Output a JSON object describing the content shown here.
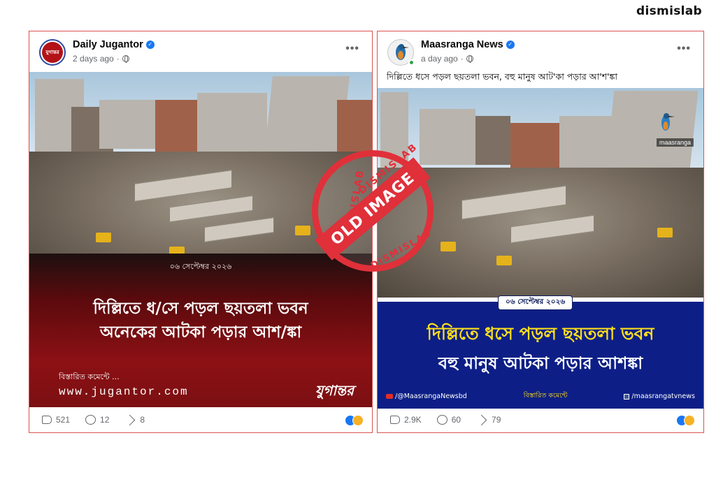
{
  "brand": {
    "name": "dismislab"
  },
  "left_post": {
    "page_name": "Daily Jugantor",
    "time": "2 days ago",
    "avatar_text": "যুগান্তর",
    "media": {
      "date": "০৬ সেপ্টেম্বর ২০২৬",
      "headline_line1": "দিল্লিতে ধ/সে পড়ল ছয়তলা ভবন",
      "headline_line2": "অনেকের আটকা পড়ার আশ/ঙ্কা",
      "more_text": "বিস্তারিত কমেন্টে ...",
      "website": "www.jugantor.com",
      "logo": "যুগান্তর"
    },
    "stats": {
      "likes": "521",
      "comments": "12",
      "shares": "8"
    }
  },
  "right_post": {
    "page_name": "Maasranga News",
    "time": "a day ago",
    "caption": "দিল্লিতে ধসে পড়ল ছয়তলা ভবন, বহু মানুষ আট'কা পড়ার আ'শ'ঙ্কা",
    "media": {
      "watermark": "maasranga",
      "date": "০৬ সেপ্টেম্বর ২০২৬",
      "headline_line1": "দিল্লিতে ধসে পড়ল ছয়তলা ভবন",
      "headline_line2": "বহু মানুষ আটকা পড়ার আশঙ্কা",
      "footer_youtube": "/@MaasrangaNewsbd",
      "footer_mid": "বিস্তারিত কমেন্টে",
      "footer_facebook": "/maasrangatvnews"
    },
    "stats": {
      "likes": "2.9K",
      "comments": "60",
      "shares": "79"
    }
  },
  "stamp": {
    "top_text": "DISMISLAB",
    "side_text": "DISMISLAB",
    "bottom_text": "DISMISLAB",
    "label": "OLD IMAGE"
  },
  "colors": {
    "stamp_red": "#e0303a",
    "jugantor_red": "#8c1115",
    "maasranga_blue": "#0d1f86",
    "maasranga_yellow": "#ffe01c",
    "facebook_blue": "#1877f2"
  }
}
